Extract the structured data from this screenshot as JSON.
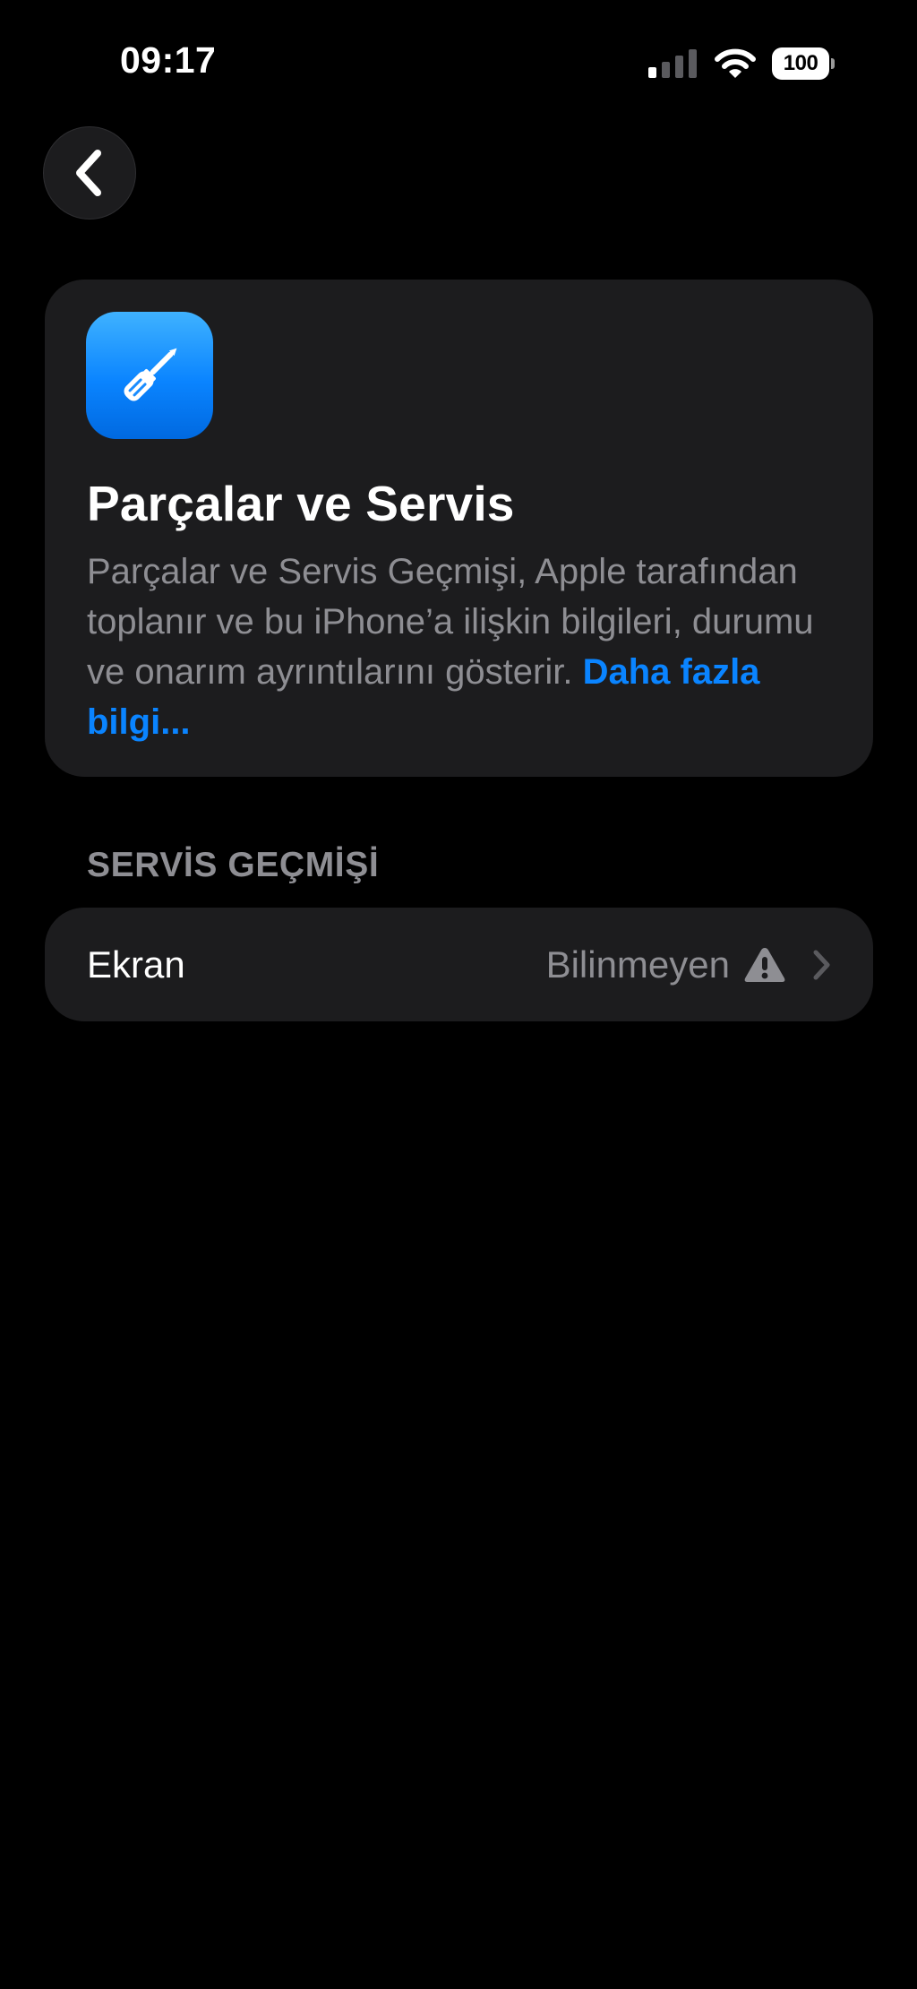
{
  "status_bar": {
    "time": "09:17",
    "battery_level": "100",
    "icons": [
      "signal-icon",
      "wifi-icon",
      "battery-icon"
    ]
  },
  "navigation": {
    "back_icon": "chevron-left-icon"
  },
  "info_card": {
    "icon": "screwdriver-icon",
    "title": "Parçalar ve Servis",
    "description": "Parçalar ve Servis Geçmişi, Apple tarafından toplanır ve bu iPhone’a ilişkin bilgileri, durumu ve onarım ayrıntılarını gösterir.",
    "link_label": "Daha fazla bilgi..."
  },
  "service_history": {
    "header": "SERVİS GEÇMİŞİ",
    "rows": [
      {
        "label": "Ekran",
        "value": "Bilinmeyen",
        "status_icon": "warning-icon",
        "accessory_icon": "chevron-right-icon"
      }
    ]
  },
  "colors": {
    "background": "#000000",
    "card_background": "#1c1c1e",
    "secondary_text": "#8e8e93",
    "link": "#0a84ff",
    "icon_gradient_top": "#3fb2ff",
    "icon_gradient_bottom": "#0069e0"
  }
}
